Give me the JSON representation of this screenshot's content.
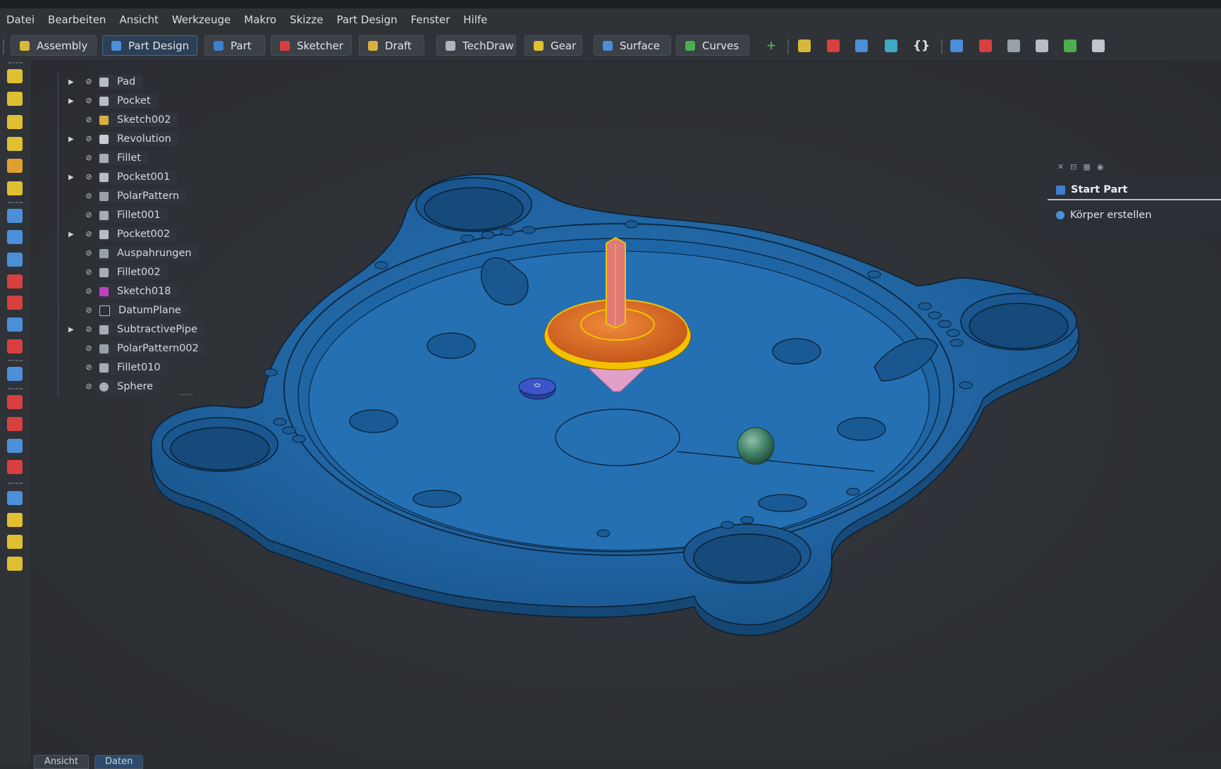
{
  "menubar": {
    "items": [
      {
        "label": "Datei"
      },
      {
        "label": "Bearbeiten"
      },
      {
        "label": "Ansicht"
      },
      {
        "label": "Werkzeuge"
      },
      {
        "label": "Makro"
      },
      {
        "label": "Skizze"
      },
      {
        "label": "Part Design"
      },
      {
        "label": "Fenster"
      },
      {
        "label": "Hilfe"
      }
    ]
  },
  "workbench_tabs": [
    {
      "label": "Assembly",
      "icon": "assembly-icon",
      "color": "#d6b93a",
      "active": false
    },
    {
      "label": "Part Design",
      "icon": "part-design-icon",
      "color": "#4a8fd8",
      "active": true
    },
    {
      "label": "Part",
      "icon": "part-icon",
      "color": "#3f7fd0",
      "active": false
    },
    {
      "label": "Sketcher",
      "icon": "sketcher-icon",
      "color": "#d84040",
      "active": false
    },
    {
      "label": "Draft",
      "icon": "draft-icon",
      "color": "#d8b040",
      "active": false
    },
    {
      "label": "TechDraw",
      "icon": "techdraw-icon",
      "color": "#b0b4bc",
      "active": false
    },
    {
      "label": "Gear",
      "icon": "gear-icon",
      "color": "#e0c030",
      "active": false
    },
    {
      "label": "Surface",
      "icon": "surface-icon",
      "color": "#4a8fd8",
      "active": false
    },
    {
      "label": "Curves",
      "icon": "curves-icon",
      "color": "#4caf50",
      "active": false
    }
  ],
  "toolbar_icons": [
    {
      "name": "add-icon",
      "glyph": "+",
      "color": "#4caf50"
    },
    {
      "name": "assembly-component-icon",
      "glyph": "",
      "color": "#d6b93a"
    },
    {
      "name": "axis-icon",
      "glyph": "",
      "color": "#d84040"
    },
    {
      "name": "folder-icon",
      "glyph": "",
      "color": "#4a8fd8"
    },
    {
      "name": "export-icon",
      "glyph": "",
      "color": "#3fa9c4"
    },
    {
      "name": "code-braces-icon",
      "glyph": "{}",
      "color": "#e0e0e0"
    },
    {
      "name": "body-icon",
      "glyph": "",
      "color": "#4a8fd8"
    },
    {
      "name": "sketch-part-icon",
      "glyph": "",
      "color": "#d84040"
    },
    {
      "name": "clone-icon",
      "glyph": "",
      "color": "#9aa0a8"
    },
    {
      "name": "pawn-icon",
      "glyph": "",
      "color": "#b8bcc4"
    },
    {
      "name": "puzzle-icon",
      "glyph": "",
      "color": "#4caf50"
    },
    {
      "name": "gnu-icon",
      "glyph": "",
      "color": "#c0c4cc"
    }
  ],
  "model_tree": {
    "items": [
      {
        "label": "Pad",
        "expandable": true,
        "icon": "pad-icon"
      },
      {
        "label": "Pocket",
        "expandable": true,
        "icon": "pocket-icon"
      },
      {
        "label": "Sketch002",
        "expandable": false,
        "icon": "sketch-icon"
      },
      {
        "label": "Revolution",
        "expandable": true,
        "icon": "revolution-icon"
      },
      {
        "label": "Fillet",
        "expandable": false,
        "icon": "fillet-icon"
      },
      {
        "label": "Pocket001",
        "expandable": true,
        "icon": "pocket-icon"
      },
      {
        "label": "PolarPattern",
        "expandable": false,
        "icon": "polar-pattern-icon"
      },
      {
        "label": "Fillet001",
        "expandable": false,
        "icon": "fillet-icon"
      },
      {
        "label": "Pocket002",
        "expandable": true,
        "icon": "pocket-icon"
      },
      {
        "label": "Auspahrungen",
        "expandable": false,
        "icon": "polar-pattern-icon"
      },
      {
        "label": "Fillet002",
        "expandable": false,
        "icon": "fillet-icon"
      },
      {
        "label": "Sketch018",
        "expandable": false,
        "icon": "sketch-attached-icon"
      },
      {
        "label": "DatumPlane",
        "expandable": false,
        "icon": "datum-plane-icon"
      },
      {
        "label": "SubtractivePipe",
        "expandable": true,
        "icon": "subtractive-pipe-icon"
      },
      {
        "label": "PolarPattern002",
        "expandable": false,
        "icon": "polar-pattern-icon"
      },
      {
        "label": "Fillet010",
        "expandable": false,
        "icon": "fillet-icon"
      },
      {
        "label": "Sphere",
        "expandable": false,
        "icon": "sphere-icon"
      }
    ],
    "more_indicator": "......"
  },
  "task_panel": {
    "header": "Start Part",
    "action": "Körper erstellen"
  },
  "bottom_tabs": [
    {
      "label": "Ansicht"
    },
    {
      "label": "Daten"
    }
  ],
  "colors": {
    "model_blue": "#1f5f99",
    "selection_yellow": "#f2c200",
    "top_orange": "#d9661c",
    "spindle_pink": "#e07a7a"
  }
}
